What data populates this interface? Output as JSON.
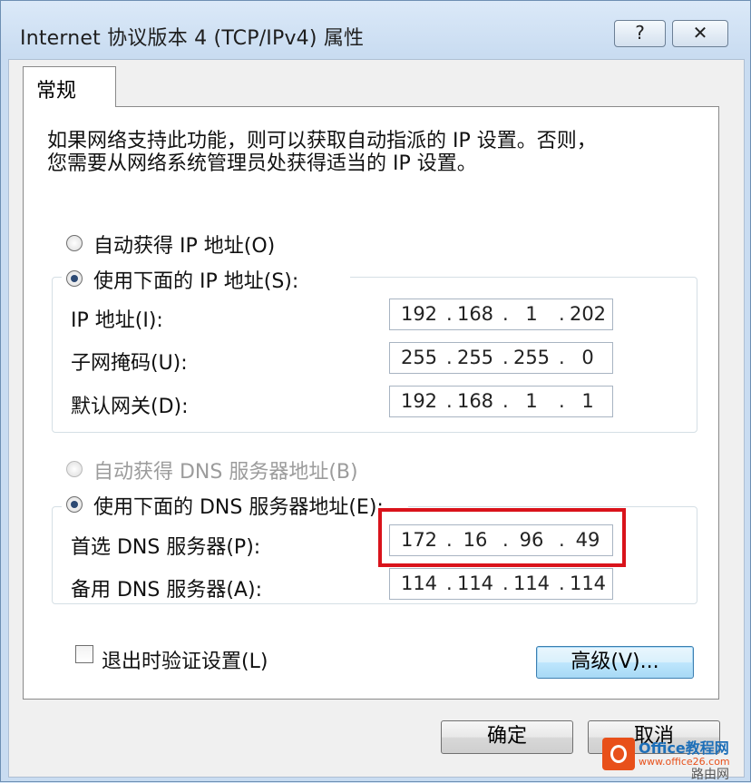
{
  "window": {
    "title": "Internet 协议版本 4 (TCP/IPv4) 属性",
    "help_label": "?",
    "close_label": "✕"
  },
  "tabs": [
    {
      "label": "常规"
    }
  ],
  "description": {
    "line1": "如果网络支持此功能，则可以获取自动指派的 IP 设置。否则，",
    "line2": "您需要从网络系统管理员处获得适当的 IP 设置。"
  },
  "ip_section": {
    "auto_radio_label": "自动获得 IP 地址(O)",
    "manual_radio_label": "使用下面的 IP 地址(S):",
    "selected": "manual",
    "fields": [
      {
        "label": "IP 地址(I):",
        "octets": [
          "192",
          "168",
          "1",
          "202"
        ]
      },
      {
        "label": "子网掩码(U):",
        "octets": [
          "255",
          "255",
          "255",
          "0"
        ]
      },
      {
        "label": "默认网关(D):",
        "octets": [
          "192",
          "168",
          "1",
          "1"
        ]
      }
    ]
  },
  "dns_section": {
    "auto_radio_label": "自动获得 DNS 服务器地址(B)",
    "manual_radio_label": "使用下面的 DNS 服务器地址(E):",
    "selected": "manual",
    "auto_disabled": true,
    "fields": [
      {
        "label": "首选 DNS 服务器(P):",
        "octets": [
          "172",
          "16",
          "96",
          "49"
        ]
      },
      {
        "label": "备用 DNS 服务器(A):",
        "octets": [
          "114",
          "114",
          "114",
          "114"
        ]
      }
    ]
  },
  "validate_checkbox": {
    "label": "退出时验证设置(L)",
    "checked": false
  },
  "buttons": {
    "advanced": "高级(V)...",
    "ok": "确定",
    "cancel": "取消"
  },
  "watermark": {
    "brand": "Office教程网",
    "url": "www.office26.com",
    "site": "路由网"
  },
  "colors": {
    "highlight": "#d9131b",
    "office_orange": "#e8501a"
  }
}
